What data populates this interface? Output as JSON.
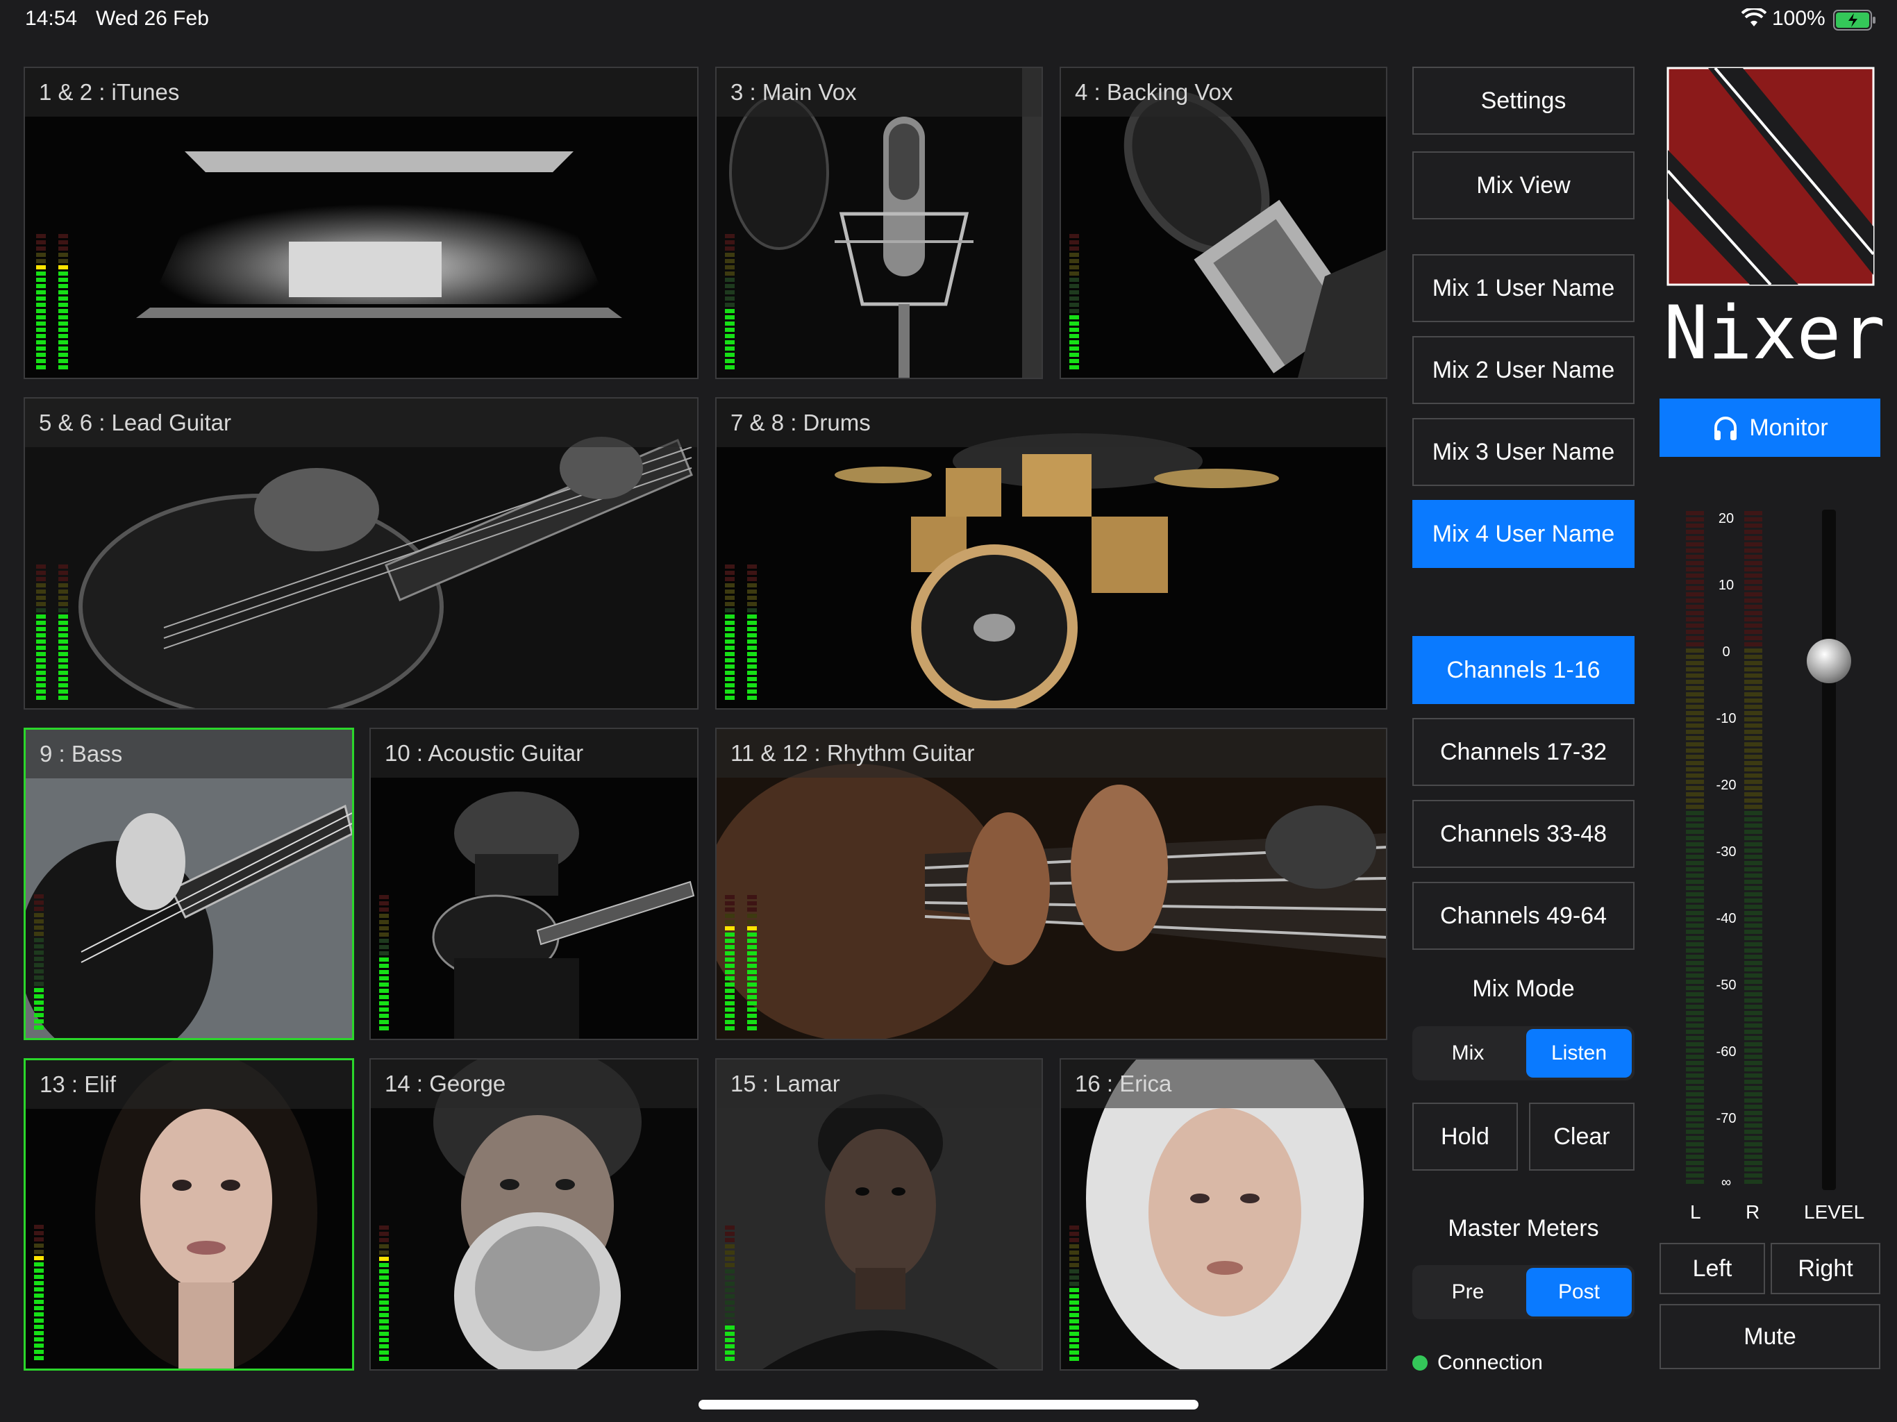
{
  "status": {
    "time": "14:54",
    "date": "Wed 26 Feb",
    "battery": "100%",
    "battery_color": "#34c759"
  },
  "tiles": [
    {
      "label": "1 & 2 : iTunes",
      "level": 0.75,
      "stereo": true,
      "photo": "laptop"
    },
    {
      "label": "3 : Main Vox",
      "level": 0.45,
      "stereo": false,
      "photo": "condenser-mic"
    },
    {
      "label": "4 : Backing Vox",
      "level": 0.4,
      "stereo": false,
      "photo": "mic-closeup"
    },
    {
      "label": "5 & 6 : Lead Guitar",
      "level": 0.62,
      "stereo": true,
      "photo": "electric-guitar"
    },
    {
      "label": "7 & 8 : Drums",
      "level": 0.62,
      "stereo": true,
      "photo": "drum-kit"
    },
    {
      "label": "9 : Bass",
      "level": 0.3,
      "stereo": false,
      "photo": "bass-guitar",
      "selected": true
    },
    {
      "label": "10 : Acoustic Guitar",
      "level": 0.55,
      "stereo": false,
      "photo": "acoustic-guitarist"
    },
    {
      "label": "11 & 12 : Rhythm Guitar",
      "level": 0.75,
      "stereo": true,
      "photo": "guitar-fretboard"
    },
    {
      "label": "13 : Elif",
      "level": 0.75,
      "stereo": false,
      "photo": "portrait",
      "selected": true
    },
    {
      "label": "14 : George",
      "level": 0.75,
      "stereo": false,
      "photo": "portrait"
    },
    {
      "label": "15 : Lamar",
      "level": 0.25,
      "stereo": false,
      "photo": "portrait"
    },
    {
      "label": "16 : Erica",
      "level": 0.55,
      "stereo": false,
      "photo": "portrait"
    }
  ],
  "menu": {
    "settings": "Settings",
    "mix_view": "Mix View",
    "mixes": [
      "Mix 1 User Name",
      "Mix 2 User Name",
      "Mix 3 User Name",
      "Mix 4 User Name"
    ],
    "active_mix": 3,
    "channel_banks": [
      "Channels 1-16",
      "Channels 17-32",
      "Channels 33-48",
      "Channels 49-64"
    ],
    "active_bank": 0,
    "mix_mode_title": "Mix Mode",
    "mix_mode_options": [
      "Mix",
      "Listen"
    ],
    "mix_mode_selected": "Listen",
    "hold": "Hold",
    "clear": "Clear",
    "master_meters_title": "Master Meters",
    "master_meter_options": [
      "Pre",
      "Post"
    ],
    "master_meter_selected": "Post",
    "connection": "Connection",
    "connection_color": "#34c759"
  },
  "brand": {
    "name": "Nixer",
    "logo_color": "#8b1a1a"
  },
  "monitor": {
    "button": "Monitor",
    "icon": "headphones-icon",
    "scale": [
      "20",
      "10",
      "0",
      "-10",
      "-20",
      "-30",
      "-40",
      "-50",
      "-60",
      "-70",
      "∞"
    ],
    "left_label": "L",
    "right_label": "R",
    "level_label": "LEVEL",
    "fader_db": 0,
    "left": "Left",
    "right": "Right",
    "mute": "Mute"
  },
  "accent": "#0a7aff"
}
